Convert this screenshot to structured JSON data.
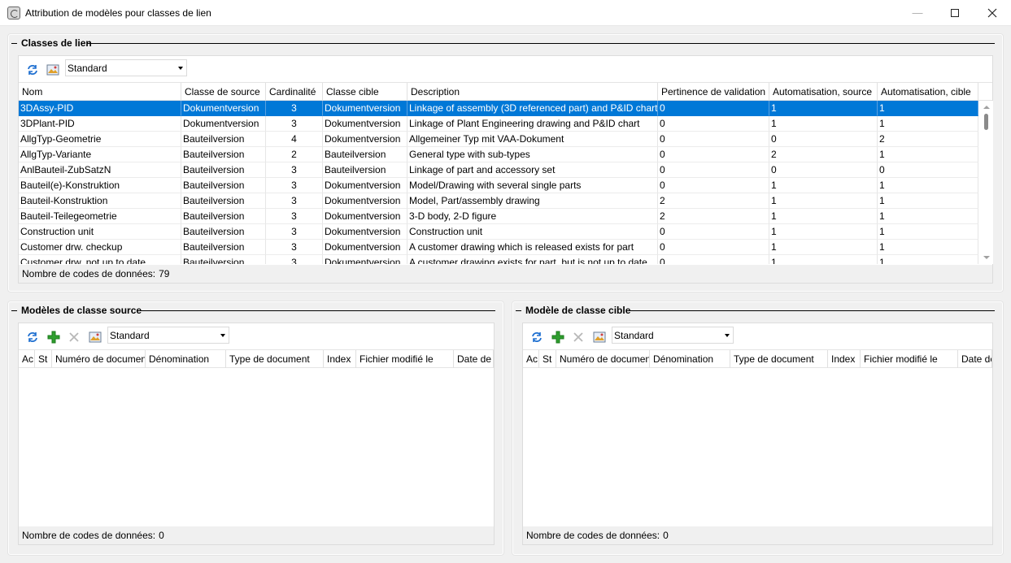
{
  "window": {
    "title": "Attribution de modèles pour classes de lien"
  },
  "link_classes": {
    "title": "Classes de lien",
    "view_select": "Standard",
    "columns": [
      "Nom",
      "Classe de source",
      "Cardinalité",
      "Classe cible",
      "Description",
      "Pertinence de validation",
      "Automatisation, source",
      "Automatisation, cible"
    ],
    "rows": [
      [
        "3DAssy-PID",
        "Dokumentversion",
        "3",
        "Dokumentversion",
        "Linkage of assembly (3D referenced part) and P&ID chart",
        "0",
        "1",
        "1"
      ],
      [
        "3DPlant-PID",
        "Dokumentversion",
        "3",
        "Dokumentversion",
        "Linkage of Plant Engineering drawing and P&ID chart",
        "0",
        "1",
        "1"
      ],
      [
        "AllgTyp-Geometrie",
        "Bauteilversion",
        "4",
        "Dokumentversion",
        "Allgemeiner Typ mit VAA-Dokument",
        "0",
        "0",
        "2"
      ],
      [
        "AllgTyp-Variante",
        "Bauteilversion",
        "2",
        "Bauteilversion",
        "General type with sub-types",
        "0",
        "2",
        "1"
      ],
      [
        "AnlBauteil-ZubSatzN",
        "Bauteilversion",
        "3",
        "Bauteilversion",
        "Linkage of part and accessory set",
        "0",
        "0",
        "0"
      ],
      [
        "Bauteil(e)-Konstruktion",
        "Bauteilversion",
        "3",
        "Dokumentversion",
        "Model/Drawing with several single parts",
        "0",
        "1",
        "1"
      ],
      [
        "Bauteil-Konstruktion",
        "Bauteilversion",
        "3",
        "Dokumentversion",
        "Model, Part/assembly drawing",
        "2",
        "1",
        "1"
      ],
      [
        "Bauteil-Teilegeometrie",
        "Bauteilversion",
        "3",
        "Dokumentversion",
        "3-D body, 2-D figure",
        "2",
        "1",
        "1"
      ],
      [
        "Construction unit",
        "Bauteilversion",
        "3",
        "Dokumentversion",
        "Construction unit",
        "0",
        "1",
        "1"
      ],
      [
        "Customer drw. checkup",
        "Bauteilversion",
        "3",
        "Dokumentversion",
        "A customer drawing which is released exists for part",
        "0",
        "1",
        "1"
      ],
      [
        "Customer drw. not up to date",
        "Bauteilversion",
        "3",
        "Dokumentversion",
        "A customer drawing exists for part, but is not up to date",
        "0",
        "1",
        "1"
      ]
    ],
    "status_label": "Nombre de codes de données:",
    "status_count": "79"
  },
  "source_models": {
    "title": "Modèles de classe source",
    "view_select": "Standard",
    "columns": [
      "Ac",
      "St",
      "Numéro de document",
      "Dénomination",
      "Type de document",
      "Index",
      "Fichier modifié le",
      "Date de création"
    ],
    "status_label": "Nombre de codes de données:",
    "status_count": "0"
  },
  "target_models": {
    "title": "Modèle de classe cible",
    "view_select": "Standard",
    "columns": [
      "Ac",
      "St",
      "Numéro de document",
      "Dénomination",
      "Type de document",
      "Index",
      "Fichier modifié le",
      "Date de création"
    ],
    "status_label": "Nombre de codes de données:",
    "status_count": "0"
  },
  "colors": {
    "selection": "#0078d7",
    "add_icon": "#2e9e2e"
  }
}
